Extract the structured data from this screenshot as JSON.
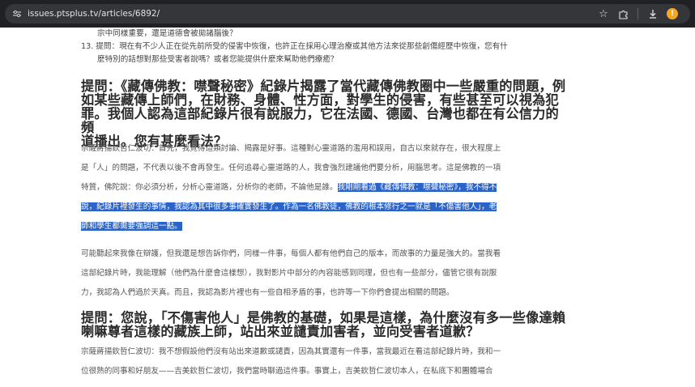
{
  "browser": {
    "url": "issues.ptsplus.tv/articles/6892/",
    "icons": [
      "site-info-icon",
      "bookmark-star-icon",
      "extensions-icon",
      "download-icon",
      "profile-extension-icon"
    ]
  },
  "article": {
    "question_list": {
      "line1": "宗中同樣重要，還是道德會被拋諸腦後？",
      "line2": "13. 提問：現在有不少人正在從先前所受的侵害中恢復，也許正在採用心理治療或其他方法來從那些創傷經歷中恢復，您有什",
      "line3": "麼特別的話想對那些受害者說嗎？或者您能提供什麼來幫助他們療癒？"
    },
    "heading1": {
      "l1": "提問：《藏傳佛教：噤聲秘密》紀錄片揭露了當代藏傳佛教圈中一些嚴重的問題，例",
      "l2": "如某些藏傳上師們，在財務、身體、性方面，對學生的侵害，有些甚至可以視為犯",
      "l3": "罪。我個人認為這部紀錄片很有說服力，它在法國、德國、台灣也都在有公信力的頻",
      "l4": "道播出。您有甚麼看法？"
    },
    "para1": {
      "l1": "宗薩蔣揚欽哲仁波切：首先，我覺得這類討論、揭露是好事。這種對心靈道路的濫用和誤用，自古以來就存在，很大程度上",
      "l2": "是「人」的問題，不代表以後不會再發生。任何追尋心靈道路的人，我會強烈建議他們要分析，用腦思考。這是佛教的一項",
      "l3_plain": "特質，佛陀說：你必須分析，分析心靈道路，分析你的老師，不論他是誰。",
      "l3_hl": "我剛剛看過《藏傳佛教：噤聲秘密》，我不得不",
      "l4_hl": "說，紀錄片裡發生的事情，我認為其中很多事確實發生了。作為一名佛教徒，佛教的根本修行之一就是「不傷害他人」，老",
      "l5_hl": "師和學生都需要強調這一點。"
    },
    "para2": {
      "l1": "可能聽起來我像在辯護，但我還是想告訴你們，同樣一件事，每個人都有他們自己的版本，而故事的力量是強大的。當我看",
      "l2": "這部紀錄片時，我能理解（他們為什麼會這樣想），我對影片中部分的內容能感到同理，但也有一些部分，儘管它很有說服",
      "l3": "力，我認為人們過於天真。而且，我認為影片裡也有一些自相矛盾的事，也許等一下你們會提出相關的問題。"
    },
    "heading2": {
      "l1": "提問：您說，「不傷害他人」是佛教的基礎，如果是這樣，為什麼沒有多一些像達賴",
      "l2": "喇嘛尊者這樣的藏族上師，站出來並譴責加害者，並向受害者道歉？"
    },
    "para3": {
      "l1": "宗薩蔣揚欽哲仁波切：我不想假設他們沒有站出來道歉或譴責，因為其實還有一件事，當我最近在看這部紀錄片時，我和一",
      "l2": "位很熟的同事和好朋友——吉美欽哲仁波切，我們當時聊過這件事。事實上，吉美欽哲仁波切本人，在私底下和團體場合"
    }
  },
  "colors": {
    "toolbar_bg": "#202124",
    "omnibox_bg": "#35363a",
    "selection_highlight": "#2a64c8",
    "heading_text": "#2b2b2b",
    "body_text": "#555555",
    "extension_badge": "#f5a623"
  }
}
